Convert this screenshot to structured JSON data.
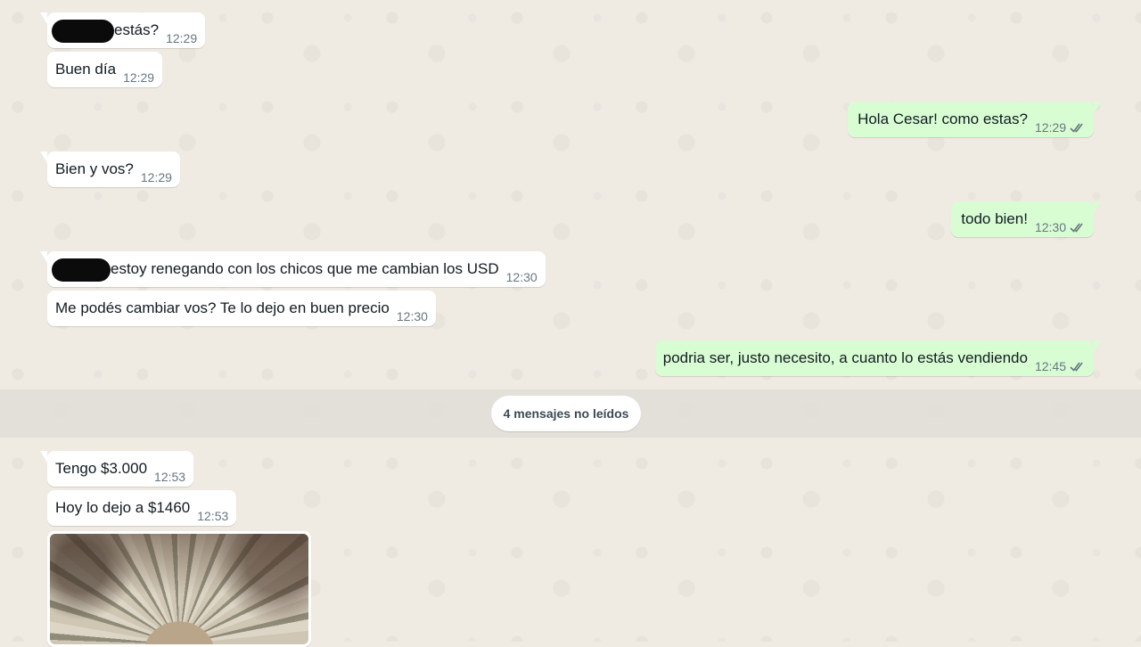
{
  "messages": [
    {
      "id": "m1",
      "dir": "in",
      "text": "estás?",
      "time": "12:29",
      "redacted_prefix": true
    },
    {
      "id": "m2",
      "dir": "in",
      "text": "Buen día",
      "time": "12:29"
    },
    {
      "id": "m3",
      "dir": "out",
      "text": "Hola Cesar! como estas?",
      "time": "12:29",
      "ticks": "read"
    },
    {
      "id": "m4",
      "dir": "in",
      "text": "Bien y vos?",
      "time": "12:29"
    },
    {
      "id": "m5",
      "dir": "out",
      "text": "todo bien!",
      "time": "12:30",
      "ticks": "read"
    },
    {
      "id": "m6",
      "dir": "in",
      "text": "estoy renegando con los chicos que me cambian los USD",
      "time": "12:30",
      "redacted_prefix": true
    },
    {
      "id": "m7",
      "dir": "in",
      "text": "Me podés cambiar vos? Te lo dejo en buen precio",
      "time": "12:30"
    },
    {
      "id": "m8",
      "dir": "out",
      "text": "podria ser, justo necesito, a cuanto lo estás vendiendo",
      "time": "12:45",
      "ticks": "read"
    },
    {
      "id": "m9",
      "dir": "in",
      "text": "Tengo $3.000",
      "time": "12:53"
    },
    {
      "id": "m10",
      "dir": "in",
      "text": "Hoy lo dejo a $1460",
      "time": "12:53"
    }
  ],
  "unread_divider": {
    "label": "4 mensajes no leídos"
  },
  "image_message": {
    "icon": "photo-attachment",
    "depicts": "photo"
  },
  "colors": {
    "wallpaper": "#efeae2",
    "incoming_bubble": "#ffffff",
    "outgoing_bubble": "#d9fdd3",
    "timestamp": "#667781",
    "read_ticks": "#667781"
  }
}
